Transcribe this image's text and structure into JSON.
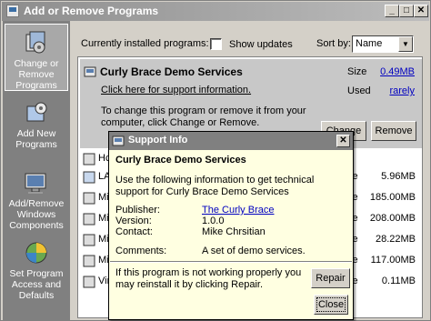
{
  "window": {
    "title": "Add or Remove Programs",
    "min_glyph": "_",
    "max_glyph": "□",
    "close_glyph": "✕"
  },
  "sidebar": {
    "items": [
      {
        "label": "Change or Remove Programs",
        "icon": "change-remove-programs-icon",
        "active": true
      },
      {
        "label": "Add New Programs",
        "icon": "add-new-programs-icon",
        "active": false
      },
      {
        "label": "Add/Remove Windows Components",
        "icon": "windows-components-icon",
        "active": false
      },
      {
        "label": "Set Program Access and Defaults",
        "icon": "program-access-icon",
        "active": false
      }
    ]
  },
  "header": {
    "installed_label": "Currently installed programs:",
    "show_updates_label": "Show updates",
    "show_updates_checked": false,
    "sort_label": "Sort by:",
    "sort_value": "Name"
  },
  "selected_program": {
    "name": "Curly Brace Demo Services",
    "size_label": "Size",
    "size_value": "0.49MB",
    "used_label": "Used",
    "used_value": "rarely",
    "support_link": "Click here for support information.",
    "change_text": "To change this program or remove it from your computer, click Change or Remove.",
    "change_button": "Change",
    "remove_button": "Remove"
  },
  "programs": [
    {
      "name": "Hc",
      "size_label": "",
      "size": ""
    },
    {
      "name": "LA",
      "size_label": "ze",
      "size": "5.96MB"
    },
    {
      "name": "Mi",
      "size_label": "ze",
      "size": "185.00MB"
    },
    {
      "name": "Mi",
      "size_label": "ze",
      "size": "208.00MB"
    },
    {
      "name": "Mi",
      "size_label": "ze",
      "size": "28.22MB"
    },
    {
      "name": "Mi",
      "size_label": "ze",
      "size": "117.00MB"
    },
    {
      "name": "Vir",
      "size_label": "ze",
      "size": "0.11MB"
    }
  ],
  "dialog": {
    "title": "Support Info",
    "program_name": "Curly Brace Demo Services",
    "intro": "Use the following information to get technical support for Curly Brace Demo Services",
    "publisher_label": "Publisher:",
    "publisher_value": "The Curly Brace",
    "version_label": "Version:",
    "version_value": "1.0.0",
    "contact_label": "Contact:",
    "contact_value": "Mike Chrsitian",
    "comments_label": "Comments:",
    "comments_value": "A set of demo services.",
    "repair_text": "If this program is not working properly you may reinstall it by clicking Repair.",
    "repair_button": "Repair",
    "close_button": "Close"
  },
  "colors": {
    "title_bar": "#8d8d8d",
    "sidebar": "#808080",
    "selected_row": "#c8c8c8",
    "dialog_bg": "#ffffe1",
    "link": "#0000c0"
  }
}
